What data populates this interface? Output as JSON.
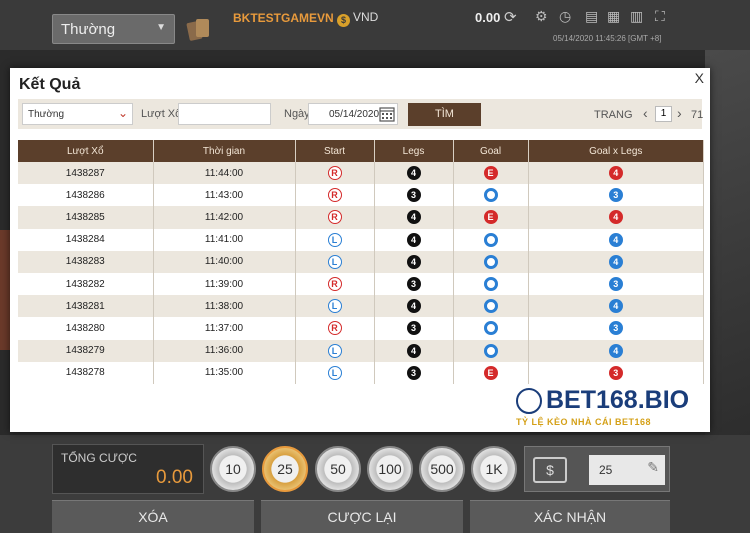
{
  "top": {
    "mode": "Thường",
    "brand": "BKTESTGAMEVN",
    "currency": "VND",
    "balance": "0.00",
    "datetime": "05/14/2020   11:45:26 [GMT +8]"
  },
  "modal": {
    "title": "Kết Quả",
    "close": "X",
    "filter": {
      "type": "Thường",
      "draw_label": "Lượt Xổ",
      "draw_value": "",
      "date_label": "Ngày",
      "date_value": "05/14/2020",
      "search": "TÌM",
      "page_label": "TRANG",
      "page": "1",
      "page_total": "71"
    },
    "columns": [
      "Lượt Xổ",
      "Thời gian",
      "Start",
      "Legs",
      "Goal",
      "Goal x Legs"
    ],
    "rows": [
      {
        "draw": "1438287",
        "time": "11:44:00",
        "start": "R",
        "legs": "4",
        "goal": "E",
        "goal_legs": "4"
      },
      {
        "draw": "1438286",
        "time": "11:43:00",
        "start": "R",
        "legs": "3",
        "goal": "O",
        "goal_legs": "3"
      },
      {
        "draw": "1438285",
        "time": "11:42:00",
        "start": "R",
        "legs": "4",
        "goal": "E",
        "goal_legs": "4"
      },
      {
        "draw": "1438284",
        "time": "11:41:00",
        "start": "L",
        "legs": "4",
        "goal": "O",
        "goal_legs": "4"
      },
      {
        "draw": "1438283",
        "time": "11:40:00",
        "start": "L",
        "legs": "4",
        "goal": "O",
        "goal_legs": "4"
      },
      {
        "draw": "1438282",
        "time": "11:39:00",
        "start": "R",
        "legs": "3",
        "goal": "O",
        "goal_legs": "3"
      },
      {
        "draw": "1438281",
        "time": "11:38:00",
        "start": "L",
        "legs": "4",
        "goal": "O",
        "goal_legs": "4"
      },
      {
        "draw": "1438280",
        "time": "11:37:00",
        "start": "R",
        "legs": "3",
        "goal": "O",
        "goal_legs": "3"
      },
      {
        "draw": "1438279",
        "time": "11:36:00",
        "start": "L",
        "legs": "4",
        "goal": "O",
        "goal_legs": "4"
      },
      {
        "draw": "1438278",
        "time": "11:35:00",
        "start": "L",
        "legs": "3",
        "goal": "E",
        "goal_legs": "3"
      }
    ]
  },
  "bottom": {
    "total_label": "TỔNG CƯỢC",
    "total_value": "0.00",
    "chips": [
      "10",
      "25",
      "50",
      "100",
      "500",
      "1K"
    ],
    "stake_symbol": "$",
    "stake_amount": "25",
    "clear": "XÓA",
    "rebet": "CƯỢC LẠI",
    "confirm": "XÁC NHẬN"
  },
  "watermark": {
    "brand": "BET168.BIO",
    "tagline": "TỶ LỆ KÈO NHÀ CÁI BET168"
  },
  "colors": {
    "header_brown": "#5b3f2b",
    "row_beige": "#ece7de",
    "accent_orange": "#e89a3c",
    "red": "#d42a2a",
    "blue": "#2a7fd4"
  }
}
